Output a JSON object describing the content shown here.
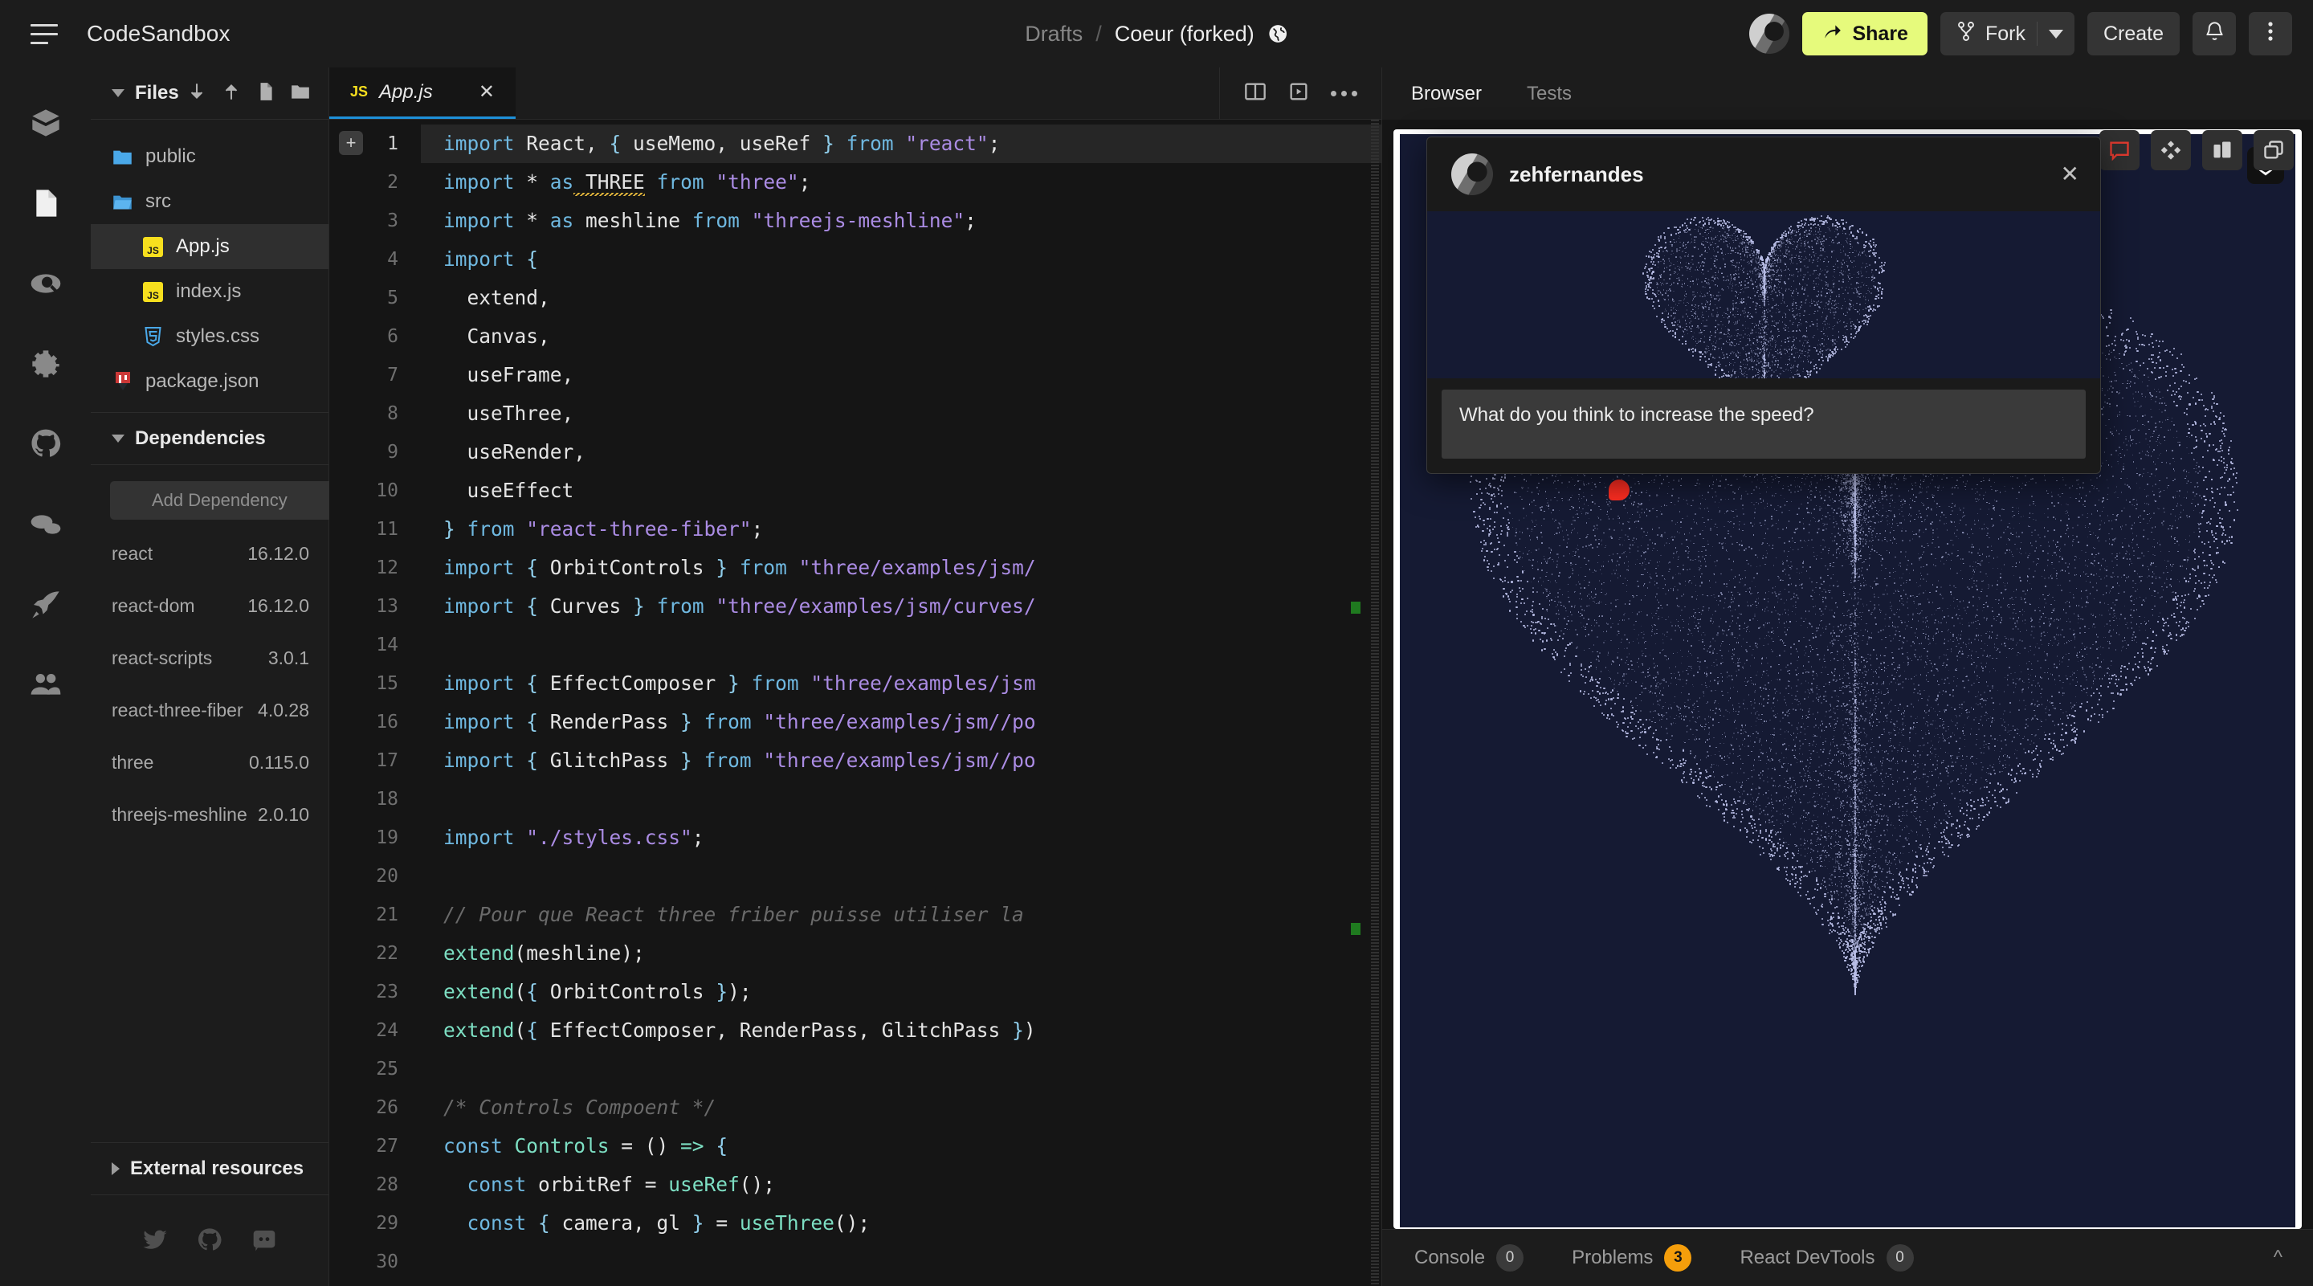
{
  "header": {
    "brand": "CodeSandbox",
    "menu_icon": "hamburger-icon",
    "breadcrumb": {
      "parent": "Drafts",
      "separator": "/",
      "title": "Coeur (forked)",
      "visibility_icon": "globe-icon"
    },
    "share_label": "Share",
    "fork_label": "Fork",
    "create_label": "Create",
    "notifications_icon": "bell-icon",
    "more_icon": "kebab-menu-icon",
    "accent_color": "#e6fa7c"
  },
  "rail": {
    "items": [
      {
        "name": "sandbox",
        "icon": "cube-icon",
        "active": false
      },
      {
        "name": "files",
        "icon": "file-icon",
        "active": true
      },
      {
        "name": "search",
        "icon": "search-icon",
        "active": false
      },
      {
        "name": "settings",
        "icon": "gear-icon",
        "active": false
      },
      {
        "name": "github",
        "icon": "github-icon",
        "active": false
      },
      {
        "name": "comments",
        "icon": "chat-icon",
        "active": false
      },
      {
        "name": "deploy",
        "icon": "rocket-icon",
        "active": false
      },
      {
        "name": "live",
        "icon": "people-icon",
        "active": false
      }
    ]
  },
  "sidebar": {
    "files_title": "Files",
    "files_actions": [
      "download-icon",
      "upload-icon",
      "new-file-icon",
      "new-folder-icon"
    ],
    "files": [
      {
        "label": "public",
        "type": "folder",
        "indent": 0,
        "selected": false
      },
      {
        "label": "src",
        "type": "folder-open",
        "indent": 0,
        "selected": false
      },
      {
        "label": "App.js",
        "type": "js",
        "indent": 1,
        "selected": true
      },
      {
        "label": "index.js",
        "type": "js",
        "indent": 1,
        "selected": false
      },
      {
        "label": "styles.css",
        "type": "css",
        "indent": 1,
        "selected": false
      },
      {
        "label": "package.json",
        "type": "npm",
        "indent": 0,
        "selected": false
      }
    ],
    "dependencies_title": "Dependencies",
    "dependency_placeholder": "Add Dependency",
    "dependencies": [
      {
        "name": "react",
        "version": "16.12.0"
      },
      {
        "name": "react-dom",
        "version": "16.12.0"
      },
      {
        "name": "react-scripts",
        "version": "3.0.1"
      },
      {
        "name": "react-three-fiber",
        "version": "4.0.28"
      },
      {
        "name": "three",
        "version": "0.115.0"
      },
      {
        "name": "threejs-meshline",
        "version": "2.0.10"
      }
    ],
    "external_resources_title": "External resources",
    "socials": [
      "twitter-icon",
      "github-icon",
      "discord-icon"
    ]
  },
  "editor": {
    "tab": {
      "label": "App.js",
      "icon": "js-icon",
      "close_icon": "close-icon"
    },
    "tools": [
      "split-view-icon",
      "preview-icon",
      "more-options-icon"
    ],
    "add_line_icon": "+",
    "lines": [
      {
        "n": "1",
        "tokens": [
          {
            "t": "kw",
            "v": "import"
          },
          {
            "t": "pl",
            "v": " React, "
          },
          {
            "t": "pun",
            "v": "{"
          },
          {
            "t": "pl",
            "v": " useMemo, useRef "
          },
          {
            "t": "pun",
            "v": "}"
          },
          {
            "t": "kw",
            "v": " from"
          },
          {
            "t": "str",
            "v": " \"react\""
          },
          {
            "t": "pl",
            "v": ";"
          }
        ],
        "current": true
      },
      {
        "n": "2",
        "tokens": [
          {
            "t": "kw",
            "v": "import"
          },
          {
            "t": "pl",
            "v": " * "
          },
          {
            "t": "kw",
            "v": "as"
          },
          {
            "t": "err",
            "v": " THREE"
          },
          {
            "t": "kw",
            "v": " from"
          },
          {
            "t": "str",
            "v": " \"three\""
          },
          {
            "t": "pl",
            "v": ";"
          }
        ]
      },
      {
        "n": "3",
        "tokens": [
          {
            "t": "kw",
            "v": "import"
          },
          {
            "t": "pl",
            "v": " * "
          },
          {
            "t": "kw",
            "v": "as"
          },
          {
            "t": "pl",
            "v": " meshline"
          },
          {
            "t": "kw",
            "v": " from"
          },
          {
            "t": "str",
            "v": " \"threejs-meshline\""
          },
          {
            "t": "pl",
            "v": ";"
          }
        ]
      },
      {
        "n": "4",
        "tokens": [
          {
            "t": "kw",
            "v": "import"
          },
          {
            "t": "pun",
            "v": " {"
          }
        ]
      },
      {
        "n": "5",
        "tokens": [
          {
            "t": "pl",
            "v": "  extend,"
          }
        ]
      },
      {
        "n": "6",
        "tokens": [
          {
            "t": "pl",
            "v": "  Canvas,"
          }
        ]
      },
      {
        "n": "7",
        "tokens": [
          {
            "t": "pl",
            "v": "  useFrame,"
          }
        ]
      },
      {
        "n": "8",
        "tokens": [
          {
            "t": "pl",
            "v": "  useThree,"
          }
        ]
      },
      {
        "n": "9",
        "tokens": [
          {
            "t": "pl",
            "v": "  useRender,"
          }
        ]
      },
      {
        "n": "10",
        "tokens": [
          {
            "t": "pl",
            "v": "  useEffect"
          }
        ]
      },
      {
        "n": "11",
        "tokens": [
          {
            "t": "pun",
            "v": "}"
          },
          {
            "t": "kw",
            "v": " from"
          },
          {
            "t": "str",
            "v": " \"react-three-fiber\""
          },
          {
            "t": "pl",
            "v": ";"
          }
        ]
      },
      {
        "n": "12",
        "tokens": [
          {
            "t": "kw",
            "v": "import"
          },
          {
            "t": "pun",
            "v": " {"
          },
          {
            "t": "pl",
            "v": " OrbitControls "
          },
          {
            "t": "pun",
            "v": "}"
          },
          {
            "t": "kw",
            "v": " from"
          },
          {
            "t": "str",
            "v": " \"three/examples/jsm/"
          }
        ]
      },
      {
        "n": "13",
        "tokens": [
          {
            "t": "kw",
            "v": "import"
          },
          {
            "t": "pun",
            "v": " {"
          },
          {
            "t": "pl",
            "v": " Curves "
          },
          {
            "t": "pun",
            "v": "}"
          },
          {
            "t": "kw",
            "v": " from"
          },
          {
            "t": "str",
            "v": " \"three/examples/jsm/curves/"
          }
        ]
      },
      {
        "n": "14",
        "tokens": []
      },
      {
        "n": "15",
        "tokens": [
          {
            "t": "kw",
            "v": "import"
          },
          {
            "t": "pun",
            "v": " {"
          },
          {
            "t": "pl",
            "v": " EffectComposer "
          },
          {
            "t": "pun",
            "v": "}"
          },
          {
            "t": "kw",
            "v": " from"
          },
          {
            "t": "str",
            "v": " \"three/examples/jsm"
          }
        ]
      },
      {
        "n": "16",
        "tokens": [
          {
            "t": "kw",
            "v": "import"
          },
          {
            "t": "pun",
            "v": " {"
          },
          {
            "t": "pl",
            "v": " RenderPass "
          },
          {
            "t": "pun",
            "v": "}"
          },
          {
            "t": "kw",
            "v": " from"
          },
          {
            "t": "str",
            "v": " \"three/examples/jsm//po"
          }
        ]
      },
      {
        "n": "17",
        "tokens": [
          {
            "t": "kw",
            "v": "import"
          },
          {
            "t": "pun",
            "v": " {"
          },
          {
            "t": "pl",
            "v": " GlitchPass "
          },
          {
            "t": "pun",
            "v": "}"
          },
          {
            "t": "kw",
            "v": " from"
          },
          {
            "t": "str",
            "v": " \"three/examples/jsm//po"
          }
        ]
      },
      {
        "n": "18",
        "tokens": []
      },
      {
        "n": "19",
        "tokens": [
          {
            "t": "kw",
            "v": "import"
          },
          {
            "t": "str",
            "v": " \"./styles.css\""
          },
          {
            "t": "pl",
            "v": ";"
          }
        ]
      },
      {
        "n": "20",
        "tokens": []
      },
      {
        "n": "21",
        "tokens": [
          {
            "t": "cm",
            "v": "// Pour que React three friber puisse utiliser la"
          }
        ]
      },
      {
        "n": "22",
        "tokens": [
          {
            "t": "fn",
            "v": "extend"
          },
          {
            "t": "pl",
            "v": "(meshline);"
          }
        ]
      },
      {
        "n": "23",
        "tokens": [
          {
            "t": "fn",
            "v": "extend"
          },
          {
            "t": "pl",
            "v": "("
          },
          {
            "t": "pun",
            "v": "{"
          },
          {
            "t": "pl",
            "v": " OrbitControls "
          },
          {
            "t": "pun",
            "v": "}"
          },
          {
            "t": "pl",
            "v": ");"
          }
        ]
      },
      {
        "n": "24",
        "tokens": [
          {
            "t": "fn",
            "v": "extend"
          },
          {
            "t": "pl",
            "v": "("
          },
          {
            "t": "pun",
            "v": "{"
          },
          {
            "t": "pl",
            "v": " EffectComposer, RenderPass, GlitchPass "
          },
          {
            "t": "pun",
            "v": "}"
          },
          {
            "t": "pl",
            "v": ")"
          }
        ]
      },
      {
        "n": "25",
        "tokens": []
      },
      {
        "n": "26",
        "tokens": [
          {
            "t": "cm",
            "v": "/* Controls Compoent */"
          }
        ]
      },
      {
        "n": "27",
        "tokens": [
          {
            "t": "kw",
            "v": "const"
          },
          {
            "t": "fn",
            "v": " Controls"
          },
          {
            "t": "pl",
            "v": " = () "
          },
          {
            "t": "fn",
            "v": "=>"
          },
          {
            "t": "pun",
            "v": " {"
          }
        ]
      },
      {
        "n": "28",
        "tokens": [
          {
            "t": "kw",
            "v": "  const"
          },
          {
            "t": "pl",
            "v": " orbitRef = "
          },
          {
            "t": "fn",
            "v": "useRef"
          },
          {
            "t": "pl",
            "v": "();"
          }
        ]
      },
      {
        "n": "29",
        "tokens": [
          {
            "t": "kw",
            "v": "  const"
          },
          {
            "t": "pun",
            "v": " {"
          },
          {
            "t": "pl",
            "v": " camera, gl "
          },
          {
            "t": "pun",
            "v": "}"
          },
          {
            "t": "pl",
            "v": " = "
          },
          {
            "t": "fn",
            "v": "useThree"
          },
          {
            "t": "pl",
            "v": "();"
          }
        ]
      },
      {
        "n": "30",
        "tokens": []
      }
    ]
  },
  "preview": {
    "tabs": [
      {
        "label": "Browser",
        "active": true
      },
      {
        "label": "Tests",
        "active": false
      }
    ],
    "toolbar": [
      "comment-icon",
      "react-devtools-icon",
      "responsive-mode-icon",
      "open-in-new-window-icon"
    ],
    "browser_badge_icon": "brave-shield-icon",
    "cursor_icon": "red-cursor-dot"
  },
  "statusbar": {
    "items": [
      {
        "label": "Console",
        "count": "0",
        "warn": false
      },
      {
        "label": "Problems",
        "count": "3",
        "warn": true
      },
      {
        "label": "React DevTools",
        "count": "0",
        "warn": false
      }
    ],
    "collapse_icon": "chevron-up-icon"
  },
  "comment_card": {
    "username": "zehfernandes",
    "close_icon": "close-icon",
    "message": "What do you think to increase the speed?"
  }
}
